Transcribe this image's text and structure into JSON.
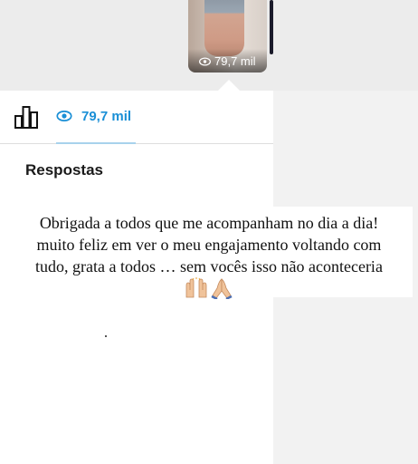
{
  "story_preview": {
    "views": "79,7 mil"
  },
  "stats": {
    "views_count": "79,7 mil"
  },
  "section": {
    "title": "Respostas"
  },
  "caption": {
    "line1": "Obrigada a todos que me acompanham no dia a dia!",
    "line2": "muito feliz em ver o meu engajamento voltando com",
    "line3": "tudo, grata a todos … sem vocês isso não aconteceria",
    "emoji": [
      "raising-hands",
      "folded-hands"
    ]
  },
  "colors": {
    "accent": "#1a8fd6",
    "tab_underline": "#a8d2ec"
  }
}
